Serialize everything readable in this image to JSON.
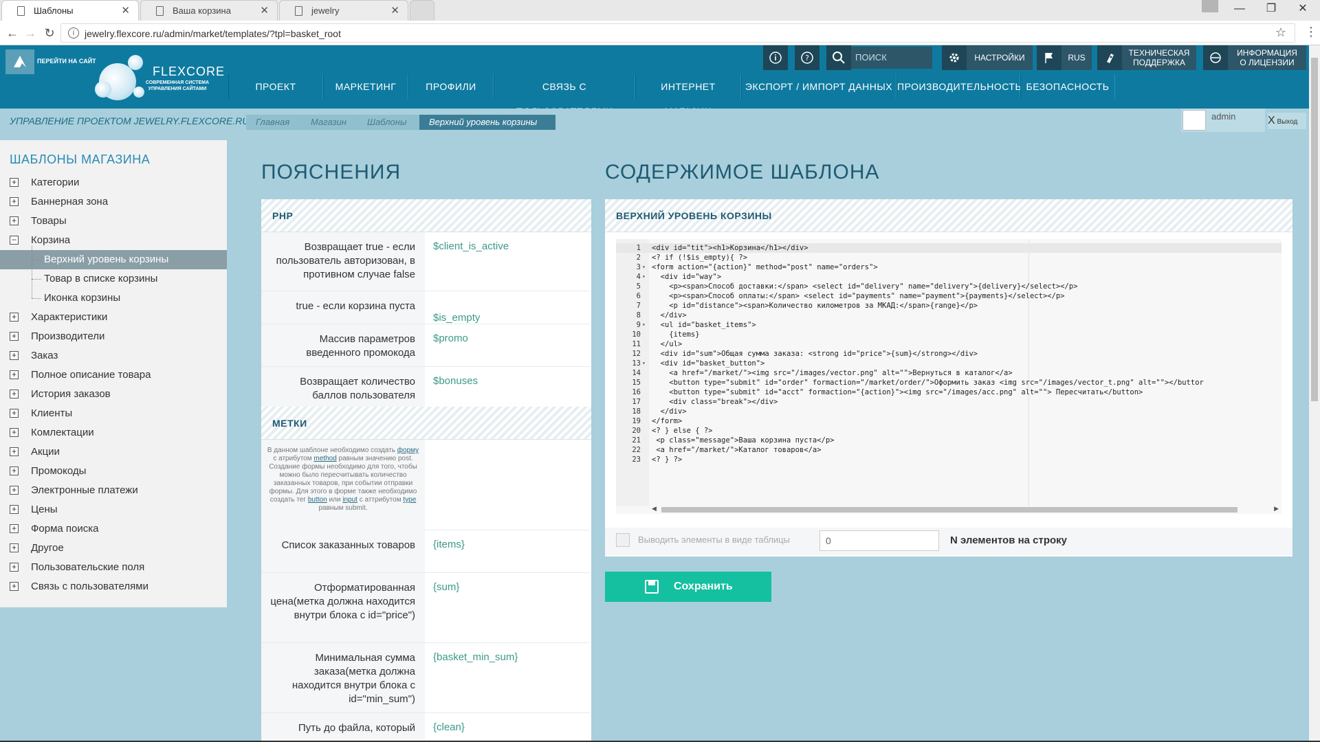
{
  "browser": {
    "tabs": [
      {
        "title": "Шаблоны",
        "active": true
      },
      {
        "title": "Ваша корзина",
        "active": false
      },
      {
        "title": "jewelry",
        "active": false
      }
    ],
    "url": "jewelry.flexcore.ru/admin/market/templates/?tpl=basket_root"
  },
  "header": {
    "go_site": "ПЕРЕЙТИ НА САЙТ",
    "logo_text": "FLEXCORE",
    "logo_sub": "СОВРЕМЕННАЯ СИСТЕМА УПРАВЛЕНИЯ САЙТАМИ",
    "search_placeholder": "ПОИСК",
    "settings": "НАСТРОЙКИ",
    "lang": "RUS",
    "support_line1": "ТЕХНИЧЕСКАЯ",
    "support_line2": "ПОДДЕРЖКА",
    "license_line1": "ИНФОРМАЦИЯ",
    "license_line2": "О ЛИЦЕНЗИИ",
    "menu": [
      "ПРОЕКТ",
      "МАРКЕТИНГ",
      "ПРОФИЛИ",
      "СВЯЗЬ С ПОЛЬЗОВАТЕЛЯМИ",
      "ИНТЕРНЕТ МАГАЗИН",
      "ЭКСПОРТ / ИМПОРТ ДАННЫХ",
      "ПРОИЗВОДИТЕЛЬНОСТЬ",
      "БЕЗОПАСНОСТЬ"
    ]
  },
  "crumbbar": {
    "project": "УПРАВЛЕНИЕ ПРОЕКТОМ JEWELRY.FLEXCORE.RU",
    "crumbs": [
      "Главная",
      "Магазин",
      "Шаблоны",
      "Верхний уровень корзины"
    ],
    "admin": "admin",
    "logout": "Выход"
  },
  "sidebar": {
    "title": "ШАБЛОНЫ МАГАЗИНА",
    "items": [
      {
        "label": "Категории",
        "type": "plus"
      },
      {
        "label": "Баннерная зона",
        "type": "plus"
      },
      {
        "label": "Товары",
        "type": "plus"
      },
      {
        "label": "Корзина",
        "type": "minus"
      },
      {
        "label": "Верхний уровень корзины",
        "type": "child",
        "selected": true
      },
      {
        "label": "Товар в списке корзины",
        "type": "child"
      },
      {
        "label": "Иконка корзины",
        "type": "child"
      },
      {
        "label": "Характеристики",
        "type": "plus"
      },
      {
        "label": "Производители",
        "type": "plus"
      },
      {
        "label": "Заказ",
        "type": "plus"
      },
      {
        "label": "Полное описание товара",
        "type": "plus"
      },
      {
        "label": "История заказов",
        "type": "plus"
      },
      {
        "label": "Клиенты",
        "type": "plus"
      },
      {
        "label": "Комлектации",
        "type": "plus"
      },
      {
        "label": "Акции",
        "type": "plus"
      },
      {
        "label": "Промокоды",
        "type": "plus"
      },
      {
        "label": "Электронные платежи",
        "type": "plus"
      },
      {
        "label": "Цены",
        "type": "plus"
      },
      {
        "label": "Форма поиска",
        "type": "plus"
      },
      {
        "label": "Другое",
        "type": "plus"
      },
      {
        "label": "Пользовательские поля",
        "type": "plus"
      },
      {
        "label": "Связь с пользователями",
        "type": "plus"
      }
    ]
  },
  "explain": {
    "title": "ПОЯСНЕНИЯ",
    "php_head": "PHP",
    "php_rows": [
      {
        "desc": "Возвращает true - если пользователь авторизован, в противном случае false",
        "var": "$client_is_active"
      },
      {
        "desc": "true - если корзина пуста",
        "var": "$is_empty"
      },
      {
        "desc": "Массив параметров введенного промокода",
        "var": "$promo"
      },
      {
        "desc": "Возвращает количество баллов пользователя",
        "var": "$bonuses"
      }
    ],
    "marks_head": "МЕТКИ",
    "hint_parts": [
      "В данном шаблоне необходимо создать ",
      "форму",
      " с атрибутом ",
      "method",
      " равным значению post. Создание формы необходимо для того, чтобы можно было пересчитывать количество заказанных товаров, при событии отправки формы. Для этого в форме также необходимо создать тег ",
      "button",
      " или ",
      "input",
      " с аттрибутом ",
      "type",
      " равным submit."
    ],
    "mark_rows": [
      {
        "desc": "Список заказанных товаров",
        "var": "{items}"
      },
      {
        "desc": "Отформатированная цена(метка должна находится внутри блока с id=\"price\")",
        "var": "{sum}"
      },
      {
        "desc": "Минимальная сумма заказа(метка должна находится внутри блока с id=\"min_sum\")",
        "var": "{basket_min_sum}"
      },
      {
        "desc": "Путь до файла, который",
        "var": "{clean}"
      }
    ]
  },
  "template": {
    "title": "СОДЕРЖИМОЕ ШАБЛОНА",
    "panel_head": "ВЕРХНИЙ УРОВЕНЬ КОРЗИНЫ",
    "code": [
      "<div id=\"tit\"><h1>Корзина</h1></div>",
      "<? if (!$is_empty){ ?>",
      "<form action=\"{action}\" method=\"post\" name=\"orders\">",
      "  <div id=\"way\">",
      "    <p><span>Способ доставки:</span> <select id=\"delivery\" name=\"delivery\">{delivery}</select></p>",
      "    <p><span>Способ оплаты:</span> <select id=\"payments\" name=\"payment\">{payments}</select></p>",
      "    <p id=\"distance\"><span>Количество километров за МКАД:</span>{range}</p>",
      "  </div>",
      "  <ul id=\"basket_items\">",
      "    {items}",
      "  </ul>",
      "  <div id=\"sum\">Общая сумма заказа: <strong id=\"price\">{sum}</strong></div>",
      "  <div id=\"basket_button\">",
      "    <a href=\"/market/\"><img src=\"/images/vector.png\" alt=\"\">Вернуться в каталог</a>",
      "    <button type=\"submit\" id=\"order\" formaction=\"/market/order/\">Оформить заказ <img src=\"/images/vector_t.png\" alt=\"\"></buttor",
      "    <button type=\"submit\" id=\"acct\" formaction=\"{action}\"><img src=\"/images/acc.png\" alt=\"\"> Пересчитать</button>",
      "    <div class=\"break\"></div>",
      "  </div>",
      "</form>",
      "<? } else { ?>",
      " <p class=\"message\">Ваша корзина пуста</p>",
      " <a href=\"/market/\">Каталог товаров</a>",
      "<? } ?>"
    ],
    "fold_lines": [
      3,
      4,
      9,
      13
    ],
    "table_option": "Выводить элементы в виде таблицы",
    "n_value": "0",
    "n_label": "N элементов на строку",
    "save": "Сохранить"
  }
}
